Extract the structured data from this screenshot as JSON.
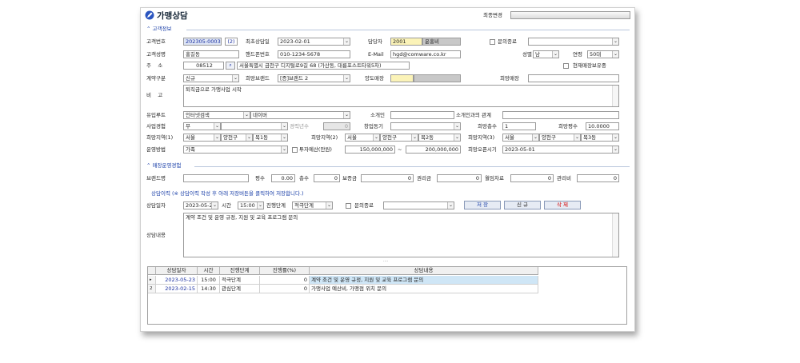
{
  "title": "가맹상담",
  "last_change": {
    "label": "최종변경",
    "value": ""
  },
  "sections": {
    "customer": "고객정보",
    "store_exp": "매장운영경험",
    "history": "상담이력 (※ 상담이력 작성 후 아래 저장버튼을 클릭하여 저장합니다.)"
  },
  "labels": {
    "customer_no": "고객번호",
    "first_date": "최초상담일",
    "manager": "담당자",
    "inquiry_end": "문의종료",
    "customer_name": "고객성명",
    "mobile": "핸드폰번호",
    "email": "E-Mail",
    "gender": "성별",
    "age": "연령",
    "address": "주    소",
    "current_store": "현재매장보유중",
    "contract_type": "계약구분",
    "hope_brand": "희망브랜드",
    "transfer_store": "양도매장",
    "hope_store": "희망매장",
    "note": "비    고",
    "inflow": "유입루트",
    "introducer": "소개인",
    "relation": "소개인과의 관계",
    "biz_exp": "사업경험",
    "career_years": "경력년수",
    "startup_motive": "창업동기",
    "hope_floors": "희망층수",
    "hope_area": "희망평수",
    "region1": "희망지역(1)",
    "region2": "희망지역(2)",
    "region3": "희망지역(3)",
    "op_method": "운영방법",
    "budget": "투자예산(만원)",
    "tilde": "~",
    "open_time": "희망오픈시기",
    "brand_name": "브랜드명",
    "area": "평수",
    "floors": "층수",
    "deposit": "보증금",
    "premium": "권리금",
    "monthly_rent": "월임차료",
    "mgmt_fee": "관리비",
    "consult_date": "상담일자",
    "time": "시간",
    "stage": "진행단계",
    "consult_end": "문의종료",
    "consult_content": "상담내용"
  },
  "values": {
    "customer_no": "202305-0003",
    "customer_no_btn": "(2)",
    "first_date": "2023-02-01",
    "manager_code": "2001",
    "manager_name": "윤홍비",
    "inquiry_end": "",
    "customer_name": "홍길동",
    "mobile": "010-1234-5678",
    "email": "hgd@comware.co.kr",
    "gender": "남",
    "age": "50대",
    "zip": "08512",
    "address": "서울특별시 금천구 디지털로9길 68 (가산동, 대륭포스트타워5차)",
    "contract_type": "신규",
    "hope_brand": "[증]브랜드 2",
    "transfer_store_code": "",
    "transfer_store_name": "",
    "hope_store": "",
    "note": "퇴직금으로 가맹사업 시작",
    "inflow": "인터넷검색",
    "inflow_sub": "네이버",
    "introducer": "",
    "relation": "",
    "biz_exp": "무",
    "biz_exp_sub": "",
    "career_years": "0",
    "startup_motive": "",
    "hope_floors": "1",
    "hope_area": "10.0000",
    "r1_city": "서울",
    "r1_gu": "양천구",
    "r1_dong": "목1동",
    "r2_city": "서울",
    "r2_gu": "양천구",
    "r2_dong": "목2동",
    "r3_city": "서울",
    "r3_gu": "양천구",
    "r3_dong": "목3동",
    "op_method": "가족",
    "budget_from": "150,000,000",
    "budget_to": "200,000,000",
    "open_time": "2023-05-01",
    "brand_name": "",
    "area": "0.00",
    "floors": "0",
    "deposit": "0",
    "premium": "0",
    "monthly_rent": "0",
    "mgmt_fee": "0",
    "consult_date": "2023-05-23",
    "time": "15:00",
    "stage": "적극단계",
    "consult_end_sel": "",
    "consult_content": "계약 조건 및 운영 규정, 지원 및 교육 프로그램 문의"
  },
  "buttons": {
    "save": "저 장",
    "new": "신 규",
    "delete": "삭 제"
  },
  "splitter": "....",
  "grid": {
    "headers": [
      "상담일자",
      "시간",
      "진행단계",
      "진행률(%)",
      "상담내용"
    ],
    "rows": [
      {
        "marker": "▸",
        "date": "2023-05-23",
        "time": "15:00",
        "stage": "적극단계",
        "progress": "0",
        "content": "계약 조건 및 운영 규정, 지원 및 교육 프로그램 문의"
      },
      {
        "marker": "2",
        "date": "2023-02-15",
        "time": "14:30",
        "stage": "관심단계",
        "progress": "0",
        "content": "가맹사업 예산비, 가맹점 위치 문의"
      }
    ]
  },
  "colors": {
    "accent": "#1a3fa8",
    "save": "#1a3fa8",
    "delete": "#d40000"
  }
}
